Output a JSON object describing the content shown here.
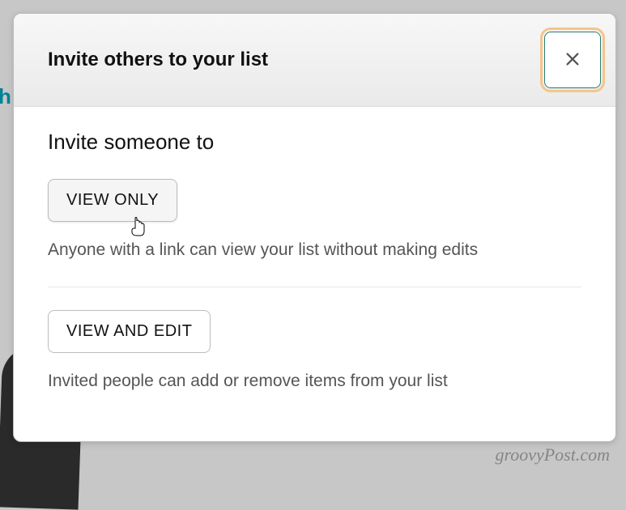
{
  "modal": {
    "title": "Invite others to your list",
    "section_title": "Invite someone to",
    "options": {
      "view_only": {
        "label": "VIEW ONLY",
        "description": "Anyone with a link can view your list without making edits"
      },
      "view_and_edit": {
        "label": "VIEW AND EDIT",
        "description": "Invited people can add or remove items from your list"
      }
    }
  },
  "backdrop": {
    "top_partial": "",
    "left_partial": "h"
  },
  "watermark": "groovyPost.com"
}
